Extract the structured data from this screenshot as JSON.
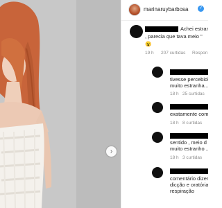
{
  "post": {
    "username": "marinaruybarbosa",
    "verified_icon": "verified-badge-icon",
    "carousel_next_icon": "chevron-right-icon"
  },
  "comments": [
    {
      "line1": "Achei estran",
      "line2": ", parecia que tava meio \"",
      "emoji": "😮",
      "time": "19 h",
      "likes": "207 curtidas",
      "reply": "Respon"
    },
    {
      "line1": "tivesse percebido",
      "line2": "muito estranha...",
      "time": "18 h",
      "likes": "25 curtidas"
    },
    {
      "line1": "exatamente com",
      "time": "18 h",
      "likes": "8 curtidas"
    },
    {
      "line1": "sentido , meio d",
      "line2": "muito estranho ..",
      "time": "18 h",
      "likes": "3 curtidas"
    },
    {
      "line1": "comentário dizer",
      "line2": "dicção e oratória",
      "line3": "respiração"
    }
  ],
  "colors": {
    "verified": "#3897f0",
    "redaction": "#000000",
    "muted_text": "#8e8e8e"
  }
}
